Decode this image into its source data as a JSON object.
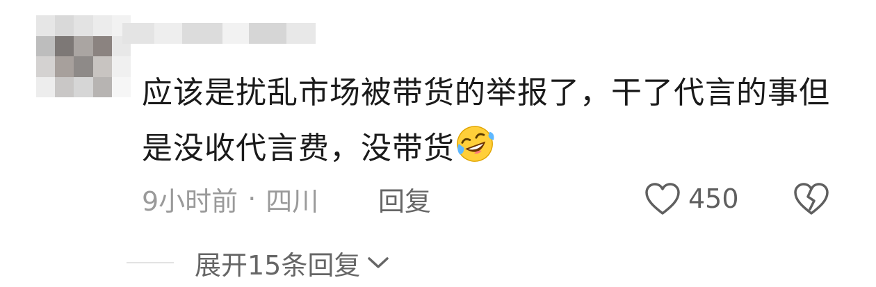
{
  "comment": {
    "text": "应该是扰乱市场被带货的举报了，干了代言的事但是没收代言费，没带货",
    "emoji": "rofl-emoji",
    "time": "9小时前",
    "separator": "·",
    "location": "四川",
    "reply_label": "回复",
    "like_count": "450",
    "like_icon": "heart-outline-icon",
    "dislike_icon": "broken-heart-icon"
  },
  "replies": {
    "expand_label": "展开15条回复",
    "icon": "chevron-down-icon"
  },
  "colors": {
    "text": "#1a1a1a",
    "meta": "#9a9a9a",
    "action": "#666666",
    "icon": "#5f5f5f"
  }
}
